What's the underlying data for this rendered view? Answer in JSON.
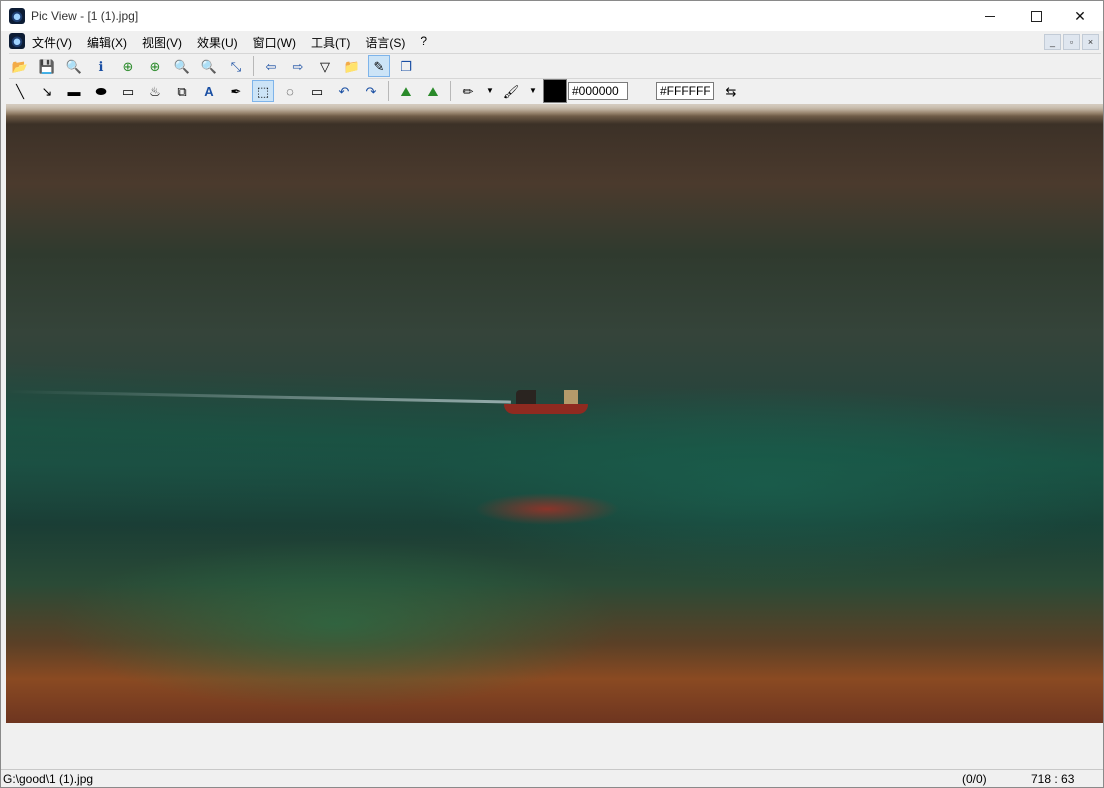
{
  "window": {
    "title": "Pic View - [1 (1).jpg]",
    "controls": {
      "minimize": "—",
      "maximize": "☐",
      "close": "✕"
    }
  },
  "menu": {
    "items": [
      "文件(V)",
      "编辑(X)",
      "视图(V)",
      "效果(U)",
      "窗口(W)",
      "工具(T)",
      "语言(S)",
      "?"
    ],
    "mdi_controls": [
      "_",
      "▫",
      "×"
    ]
  },
  "toolbar1": {
    "icons": [
      {
        "name": "open-icon",
        "glyph": "📂"
      },
      {
        "name": "save-icon",
        "glyph": "💾"
      },
      {
        "name": "print-preview-icon",
        "glyph": "🔍"
      },
      {
        "name": "info-icon",
        "glyph": "ℹ"
      },
      {
        "name": "nav-prev-icon",
        "glyph": "⊕"
      },
      {
        "name": "nav-next-icon",
        "glyph": "⊕"
      },
      {
        "name": "zoom-in-icon",
        "glyph": "🔍"
      },
      {
        "name": "zoom-out-icon",
        "glyph": "🔍"
      },
      {
        "name": "fit-icon",
        "glyph": "⤡"
      },
      {
        "name": "prev-image-icon",
        "glyph": "⇦"
      },
      {
        "name": "next-image-icon",
        "glyph": "⇨"
      },
      {
        "name": "slideshow-icon",
        "glyph": "▽"
      },
      {
        "name": "folder-icon",
        "glyph": "📁"
      },
      {
        "name": "draw-mode-icon",
        "glyph": "✎"
      },
      {
        "name": "windows-icon",
        "glyph": "❐"
      }
    ]
  },
  "toolbar2": {
    "icons": [
      {
        "name": "line-tool-icon",
        "glyph": "╲"
      },
      {
        "name": "arrow-tool-icon",
        "glyph": "↘"
      },
      {
        "name": "rectangle-tool-icon",
        "glyph": "▬"
      },
      {
        "name": "ellipse-tool-icon",
        "glyph": "⬬"
      },
      {
        "name": "rounded-rect-tool-icon",
        "glyph": "▭"
      },
      {
        "name": "fill-tool-icon",
        "glyph": "♨"
      },
      {
        "name": "stamp-tool-icon",
        "glyph": "⧉"
      },
      {
        "name": "text-tool-icon",
        "glyph": "A"
      },
      {
        "name": "eyedropper-tool-icon",
        "glyph": "✒"
      },
      {
        "name": "rect-select-icon",
        "glyph": "⬚"
      },
      {
        "name": "ellipse-select-icon",
        "glyph": "◌"
      },
      {
        "name": "free-select-icon",
        "glyph": "▭"
      },
      {
        "name": "undo-icon",
        "glyph": "↶"
      },
      {
        "name": "redo-icon",
        "glyph": "↷"
      },
      {
        "name": "mountain-left-icon",
        "glyph": "⛰"
      },
      {
        "name": "mountain-right-icon",
        "glyph": "⛰"
      },
      {
        "name": "pencil-icon",
        "glyph": "✏"
      },
      {
        "name": "brush-icon",
        "glyph": "🖌"
      },
      {
        "name": "swap-colors-icon",
        "glyph": "⇆"
      }
    ],
    "foreground_color": "#000000",
    "background_color": "#FFFFFF",
    "dropdown_glyph": "▼"
  },
  "status": {
    "path": "G:\\good\\1 (1).jpg",
    "count": "(0/0)",
    "coords": "718 : 63"
  },
  "colors": {
    "accent_selected": "#cce4f7",
    "swatch": "#000000"
  }
}
